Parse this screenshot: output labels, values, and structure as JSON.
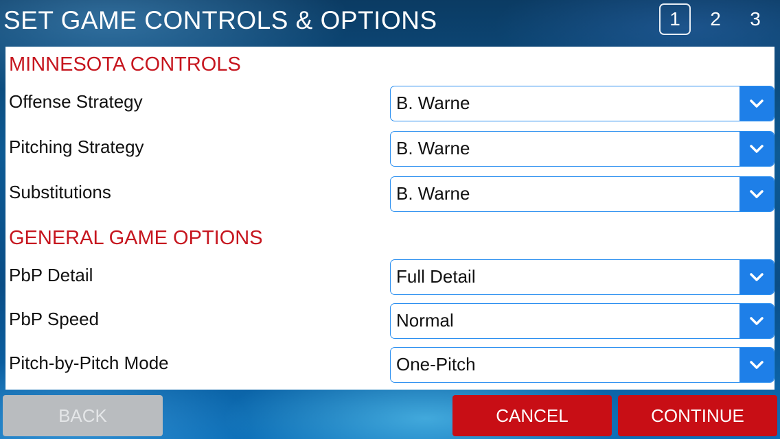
{
  "header": {
    "title": "SET GAME CONTROLS & OPTIONS",
    "pages": [
      "1",
      "2",
      "3"
    ],
    "active_page": "1"
  },
  "sections": {
    "controls": {
      "title": "MINNESOTA CONTROLS",
      "rows": [
        {
          "label": "Offense Strategy",
          "value": "B. Warne"
        },
        {
          "label": "Pitching Strategy",
          "value": "B. Warne"
        },
        {
          "label": "Substitutions",
          "value": "B. Warne"
        }
      ]
    },
    "options": {
      "title": "GENERAL GAME OPTIONS",
      "rows": [
        {
          "label": "PbP Detail",
          "value": "Full Detail"
        },
        {
          "label": "PbP Speed",
          "value": "Normal"
        },
        {
          "label": "Pitch-by-Pitch Mode",
          "value": "One-Pitch"
        }
      ]
    }
  },
  "footer": {
    "back_label": "BACK",
    "cancel_label": "CANCEL",
    "continue_label": "CONTINUE"
  },
  "icons": {
    "dropdown": "chevron-down-icon"
  },
  "colors": {
    "section_title": "#c6161f",
    "accent": "#1e7fe8",
    "primary_button": "#c80e15",
    "disabled_button": "#b9bcbf"
  }
}
